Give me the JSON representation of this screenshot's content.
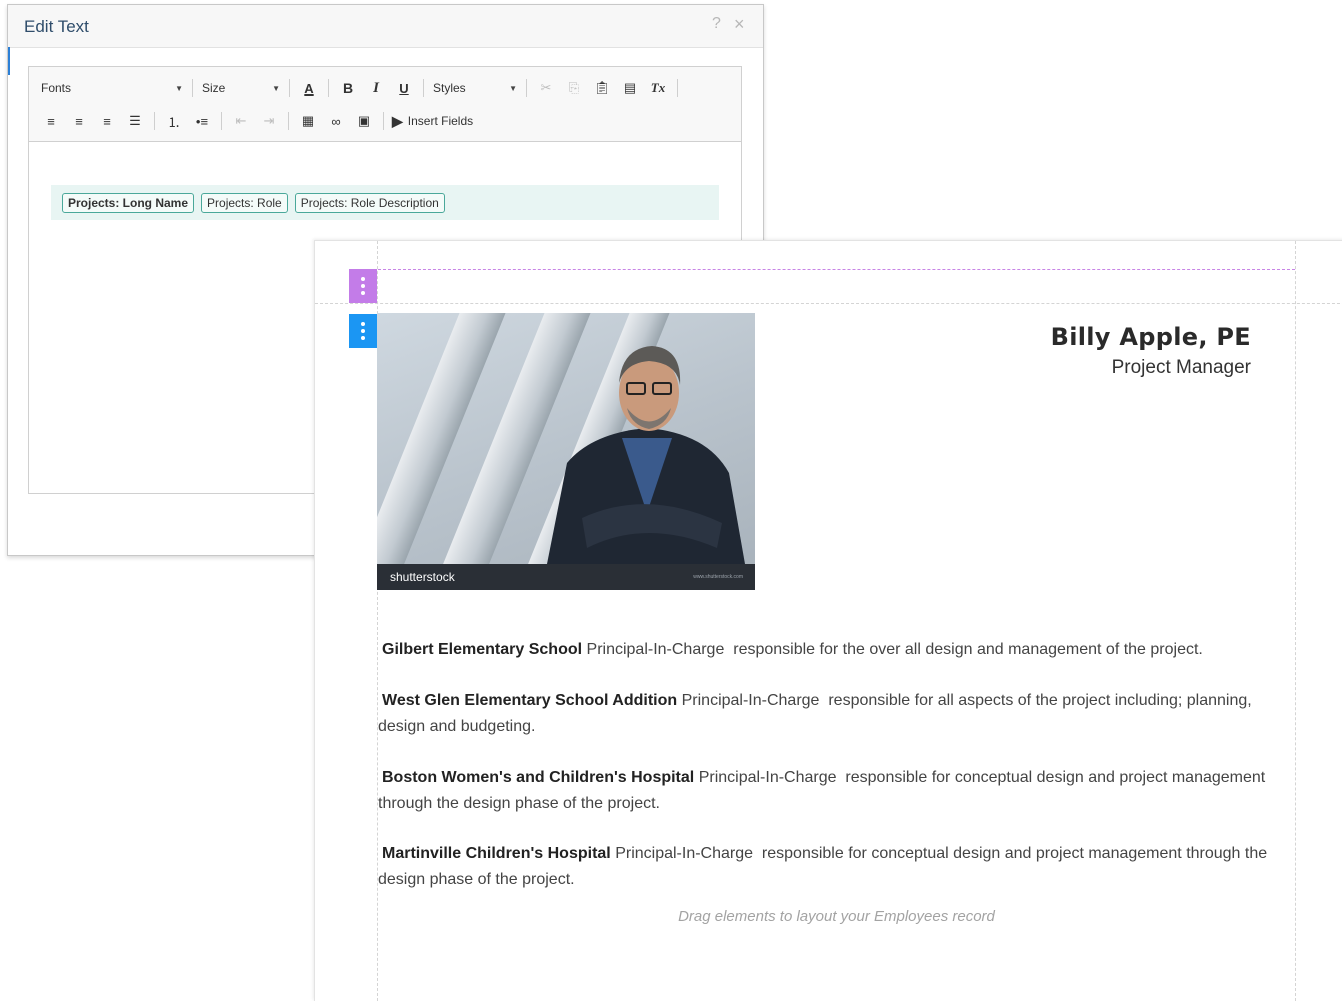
{
  "dialog": {
    "title": "Edit Text",
    "help_icon": "?",
    "close_icon": "×",
    "toolbar": {
      "fonts_label": "Fonts",
      "size_label": "Size",
      "styles_label": "Styles",
      "font_color_glyph": "A",
      "bold_glyph": "B",
      "italic_glyph": "I",
      "underline_glyph": "U",
      "clear_format_glyph": "Tx",
      "insert_fields_label": "Insert Fields"
    },
    "fields": [
      "Projects: Long Name",
      "Projects: Role",
      "Projects: Role Description"
    ]
  },
  "canvas": {
    "employee_name": "Billy Apple, PE",
    "employee_title": "Project Manager",
    "photo_watermark": "shutterstock",
    "photo_caption_small": "www.shutterstock.com",
    "projects": [
      {
        "name": "Gilbert Elementary School",
        "role": "Principal-In-Charge",
        "description": "responsible for the over all design and management of the project."
      },
      {
        "name": "West Glen Elementary School Addition",
        "role": "Principal-In-Charge",
        "description": "responsible for all aspects of the project including; planning, design and budgeting."
      },
      {
        "name": "Boston Women's and Children's Hospital",
        "role": "Principal-In-Charge",
        "description": "responsible for conceptual design and project management through the design phase of the project."
      },
      {
        "name": "Martinville Children's Hospital",
        "role": "Principal-In-Charge",
        "description": "responsible for conceptual design and project management through the design phase of the project."
      }
    ],
    "drag_hint": "Drag elements to layout your Employees record"
  },
  "colors": {
    "handle_purple": "#c37ce8",
    "handle_blue": "#1b96f3",
    "chip_border": "#4aa89a",
    "field_row_bg": "#e8f5f3"
  }
}
